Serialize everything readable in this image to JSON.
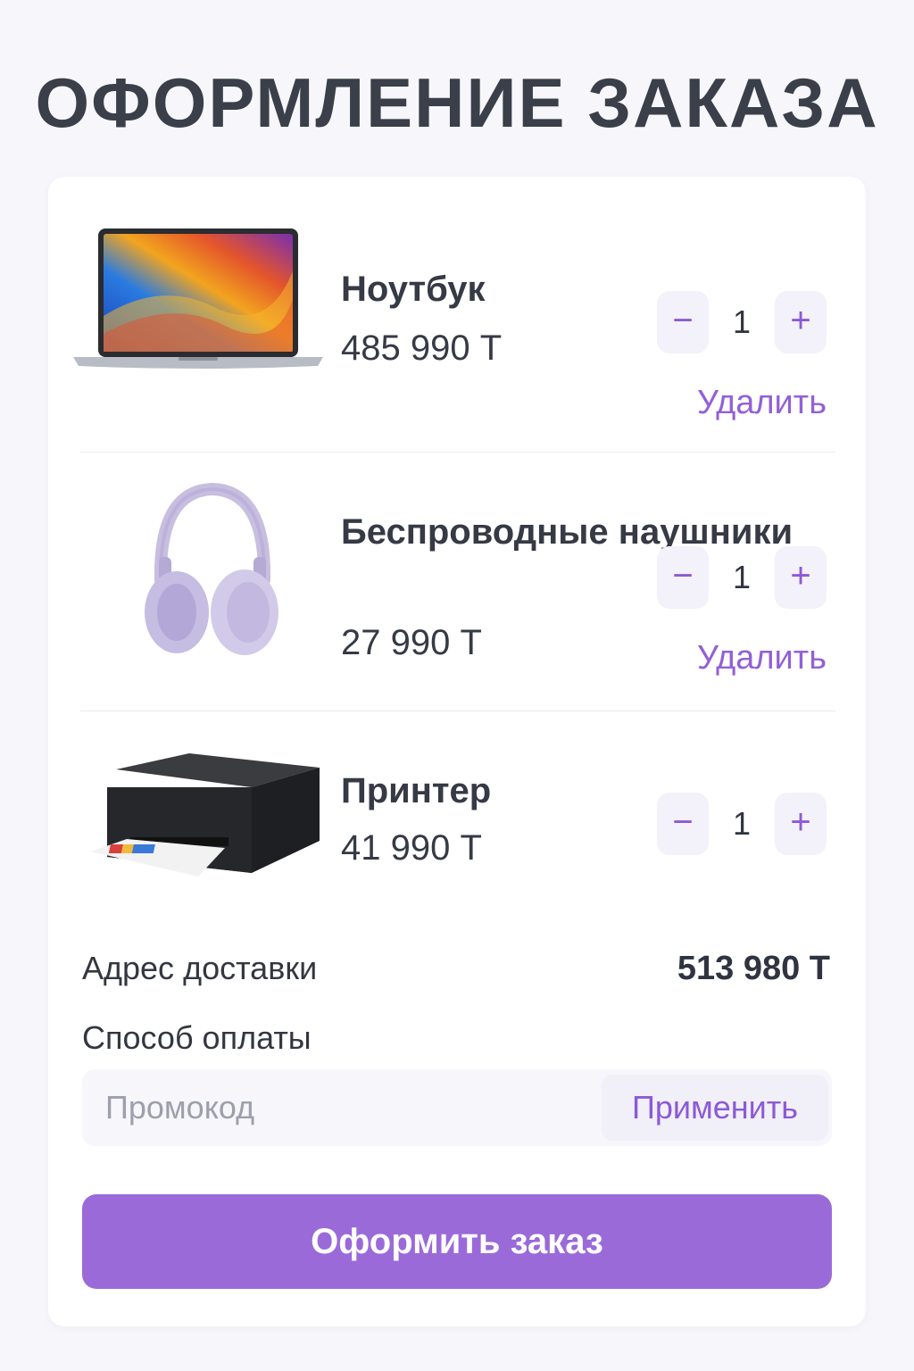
{
  "page": {
    "title": "ОФОРМЛЕНИЕ ЗАКАЗА"
  },
  "cart": {
    "items": [
      {
        "name": "Ноутбук",
        "price": "485 990 Т",
        "qty": "1",
        "minus": "−",
        "plus": "+",
        "remove_label": "Удалить",
        "image": "laptop"
      },
      {
        "name": "Беспроводные наушники",
        "price": "27 990 Т",
        "qty": "1",
        "minus": "−",
        "plus": "+",
        "remove_label": "Удалить",
        "image": "headphones"
      },
      {
        "name": "Принтер",
        "price": "41 990 Т",
        "qty": "1",
        "minus": "−",
        "plus": "+",
        "image": "printer"
      }
    ]
  },
  "summary": {
    "address_label": "Адрес доставки",
    "total": "513 980 Т",
    "payment_label": "Способ оплаты"
  },
  "promo": {
    "placeholder": "Промокод",
    "value": "",
    "apply_label": "Применить"
  },
  "checkout": {
    "submit_label": "Оформить заказ"
  },
  "colors": {
    "accent": "#9b6ad9",
    "accent_text": "#8b5ad6",
    "background": "#f7f7fb",
    "card": "#ffffff"
  }
}
